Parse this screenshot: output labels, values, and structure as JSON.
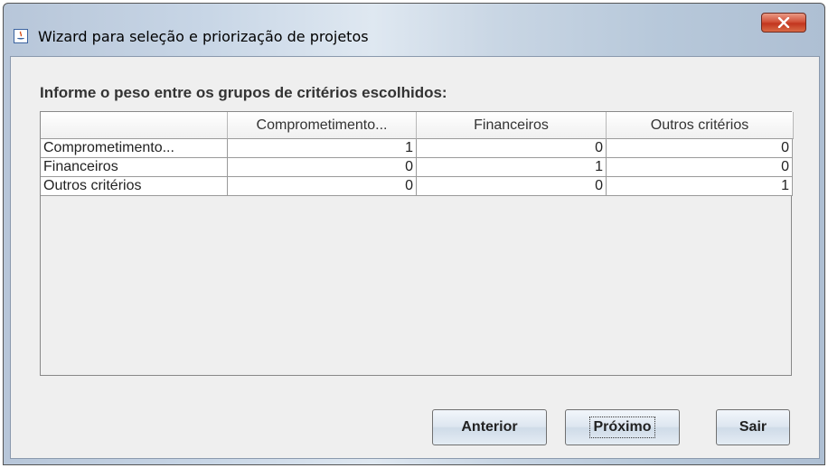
{
  "window": {
    "title": "Wizard para seleção e priorização de projetos"
  },
  "heading": "Informe o peso entre os grupos de critérios escolhidos:",
  "table": {
    "columns": [
      "",
      "Comprometimento...",
      "Financeiros",
      "Outros critérios"
    ],
    "rows": [
      {
        "label": "Comprometimento...",
        "values": [
          "1",
          "0",
          "0"
        ]
      },
      {
        "label": "Financeiros",
        "values": [
          "0",
          "1",
          "0"
        ]
      },
      {
        "label": "Outros critérios",
        "values": [
          "0",
          "0",
          "1"
        ]
      }
    ]
  },
  "buttons": {
    "previous": "Anterior",
    "next": "Próximo",
    "exit": "Sair"
  },
  "icons": {
    "app": "java-app-icon",
    "close": "close-icon"
  },
  "colors": {
    "close_button": "#c2351e",
    "panel_bg": "#efefef"
  }
}
